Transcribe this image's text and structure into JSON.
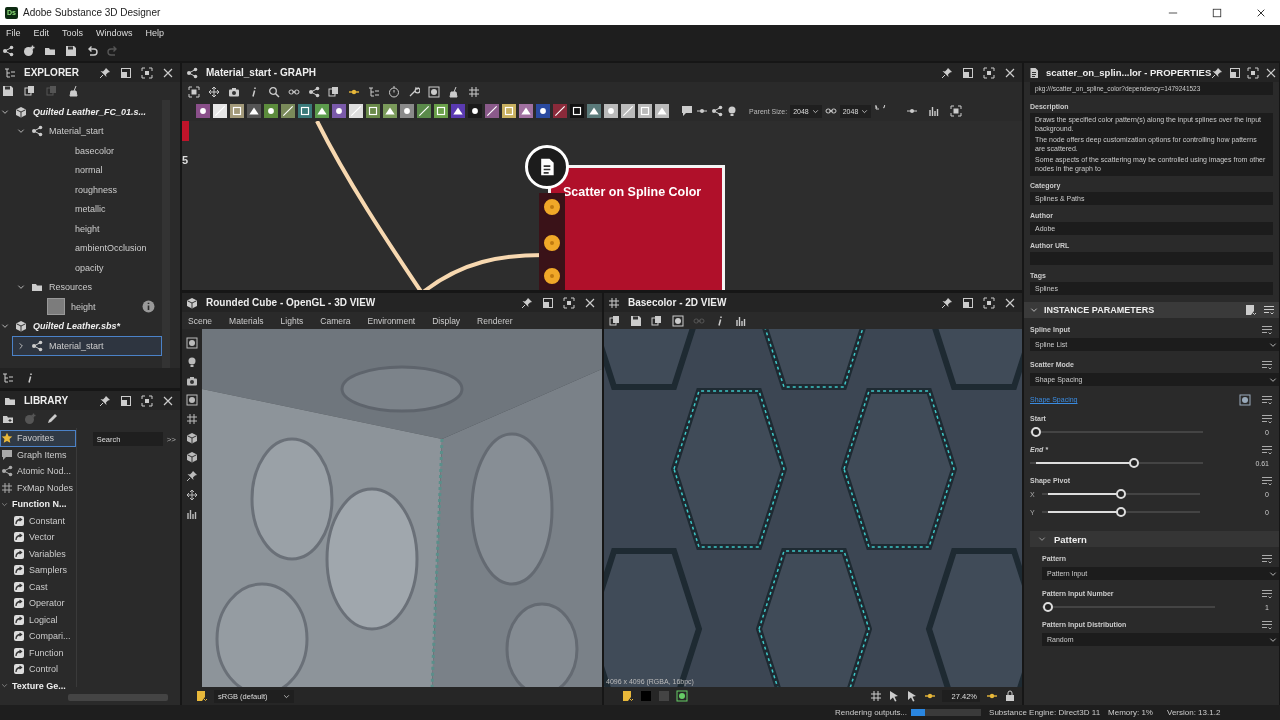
{
  "window": {
    "logo": "Ds",
    "title": "Adobe Substance 3D Designer"
  },
  "menu": [
    "File",
    "Edit",
    "Tools",
    "Windows",
    "Help"
  ],
  "explorer": {
    "title": "EXPLORER",
    "tree": [
      {
        "label": "Quilted Leather_FC_01.s...",
        "kind": "package",
        "expanded": true,
        "selected": false,
        "children": [
          {
            "label": "Material_start",
            "kind": "graph",
            "expanded": true,
            "selected": false,
            "children": [
              {
                "label": "basecolor",
                "kind": "output",
                "selected": false
              },
              {
                "label": "normal",
                "kind": "output",
                "selected": false
              },
              {
                "label": "roughness",
                "kind": "output",
                "selected": false
              },
              {
                "label": "metallic",
                "kind": "output",
                "selected": false
              },
              {
                "label": "height",
                "kind": "output",
                "selected": false
              },
              {
                "label": "ambientOcclusion",
                "kind": "output",
                "selected": false
              },
              {
                "label": "opacity",
                "kind": "output",
                "selected": false
              }
            ]
          },
          {
            "label": "Resources",
            "kind": "folder",
            "expanded": true,
            "selected": false,
            "children": [
              {
                "label": "height",
                "kind": "resource",
                "selected": false
              }
            ]
          }
        ]
      },
      {
        "label": "Quilted Leather.sbs*",
        "kind": "package",
        "expanded": true,
        "selected": false,
        "children": [
          {
            "label": "Material_start",
            "kind": "graph",
            "expanded": false,
            "selected": true
          }
        ]
      }
    ]
  },
  "library": {
    "title": "LIBRARY",
    "search": {
      "placeholder": "Search"
    },
    "more": ">>",
    "items": [
      {
        "label": "Favorites",
        "kind": "category",
        "selected": true
      },
      {
        "label": "Graph Items",
        "kind": "category",
        "selected": false
      },
      {
        "label": "Atomic Nod...",
        "kind": "category",
        "selected": false
      },
      {
        "label": "FxMap Nodes",
        "kind": "category",
        "selected": false
      },
      {
        "label": "Function N...",
        "kind": "section",
        "expanded": true,
        "selected": false
      },
      {
        "label": "Constant",
        "kind": "function",
        "selected": false
      },
      {
        "label": "Vector",
        "kind": "function",
        "selected": false
      },
      {
        "label": "Variables",
        "kind": "function",
        "selected": false
      },
      {
        "label": "Samplers",
        "kind": "function",
        "selected": false
      },
      {
        "label": "Cast",
        "kind": "function",
        "selected": false
      },
      {
        "label": "Operator",
        "kind": "function",
        "selected": false
      },
      {
        "label": "Logical",
        "kind": "function",
        "selected": false
      },
      {
        "label": "Compari...",
        "kind": "function",
        "selected": false
      },
      {
        "label": "Function",
        "kind": "function",
        "selected": false
      },
      {
        "label": "Control",
        "kind": "function",
        "selected": false
      },
      {
        "label": "Texture Ge...",
        "kind": "section",
        "expanded": true,
        "selected": false
      }
    ]
  },
  "graph": {
    "title": "Material_start - GRAPH",
    "parent_size_label": "Parent Size:",
    "parent_size": "2048",
    "output_size": "2048",
    "edge_text": "5",
    "node": {
      "title": "Scatter on Spline Color"
    }
  },
  "view3d": {
    "title": "Rounded Cube - OpenGL - 3D VIEW",
    "menu": [
      "Scene",
      "Materials",
      "Lights",
      "Camera",
      "Environment",
      "Display",
      "Renderer"
    ],
    "color_space": "sRGB (default)"
  },
  "view2d": {
    "title": "Basecolor - 2D VIEW",
    "image_info": "4096 x 4096 (RGBA, 16bpc)",
    "zoom": "27.42%"
  },
  "properties": {
    "title": "scatter_on_splin...lor - PROPERTIES",
    "url": "pkg:///scatter_on_spline_color?dependency=1479241523",
    "fields": [
      {
        "label": "Description",
        "kind": "multiline",
        "lines": [
          "Draws the specified color pattern(s) along the input splines over the input background.",
          "The node offers deep customization options for controlling how patterns are scattered.",
          "Some aspects of the scattering may be controlled using images from other nodes in the graph to"
        ]
      },
      {
        "label": "Category",
        "kind": "line",
        "value": "Splines & Paths"
      },
      {
        "label": "Author",
        "kind": "line",
        "value": "Adobe"
      },
      {
        "label": "Author URL",
        "kind": "line"
      },
      {
        "label": "Tags",
        "kind": "line",
        "value": "Splines"
      }
    ],
    "instance": {
      "title": "INSTANCE PARAMETERS",
      "expanded": true,
      "params": [
        {
          "kind": "dropdown",
          "label": "Spline Input",
          "value": "Spline List"
        },
        {
          "kind": "dropdown",
          "label": "Scatter Mode",
          "value": "Shape Spacing"
        },
        {
          "kind": "link",
          "label": "Shape Spacing"
        },
        {
          "kind": "slider",
          "label": "Start",
          "modified": false,
          "level": 0,
          "reading": "0"
        },
        {
          "kind": "slider",
          "label": "End *",
          "modified": true,
          "level": 0.61,
          "reading": "0.61"
        },
        {
          "kind": "vector",
          "label": "Shape Pivot",
          "axes": [
            {
              "axis": "X",
              "level": 0.5,
              "reading": "0"
            },
            {
              "axis": "Y",
              "level": 0.5,
              "reading": "0"
            }
          ]
        },
        {
          "kind": "group",
          "label": "Pattern",
          "expanded": true,
          "params": [
            {
              "kind": "dropdown",
              "label": "Pattern",
              "value": "Pattern Input"
            },
            {
              "kind": "slider",
              "label": "Pattern Input Number",
              "modified": false,
              "level": 0,
              "reading": "1"
            },
            {
              "kind": "dropdown",
              "label": "Pattern Input Distribution",
              "value": "Random"
            }
          ]
        }
      ]
    }
  },
  "status": {
    "message": "Rendering outputs...",
    "progress": {
      "level": 0.2
    },
    "engine": "Substance Engine: Direct3D 11",
    "memory": "Memory: 1%",
    "version": "Version: 13.1.2"
  }
}
